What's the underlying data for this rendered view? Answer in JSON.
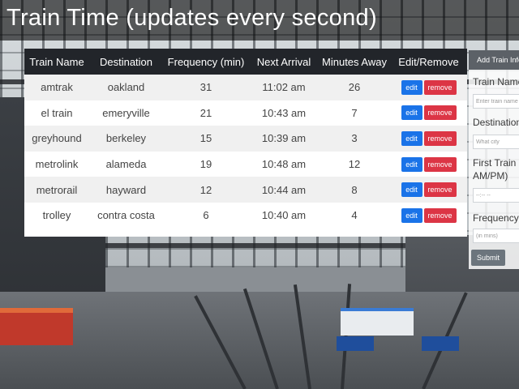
{
  "page": {
    "title": "Train Time (updates every second)"
  },
  "table": {
    "headers": [
      "Train Name",
      "Destination",
      "Frequency (min)",
      "Next Arrival",
      "Minutes Away",
      "Edit/Remove"
    ],
    "rows": [
      {
        "name": "amtrak",
        "destination": "oakland",
        "frequency": "31",
        "next_arrival": "11:02 am",
        "minutes_away": "26"
      },
      {
        "name": "el train",
        "destination": "emeryville",
        "frequency": "21",
        "next_arrival": "10:43 am",
        "minutes_away": "7"
      },
      {
        "name": "greyhound",
        "destination": "berkeley",
        "frequency": "15",
        "next_arrival": "10:39 am",
        "minutes_away": "3"
      },
      {
        "name": "metrolink",
        "destination": "alameda",
        "frequency": "19",
        "next_arrival": "10:48 am",
        "minutes_away": "12"
      },
      {
        "name": "metrorail",
        "destination": "hayward",
        "frequency": "12",
        "next_arrival": "10:44 am",
        "minutes_away": "8"
      },
      {
        "name": "trolley",
        "destination": "contra costa",
        "frequency": "6",
        "next_arrival": "10:40 am",
        "minutes_away": "4"
      }
    ],
    "edit_label": "edit",
    "remove_label": "remove"
  },
  "add_panel": {
    "header": "Add Train Info",
    "name_label": "Train Name",
    "name_placeholder": "Enter train name",
    "destination_label": "Destination",
    "destination_placeholder": "What city",
    "first_train_label_line1": "First Train",
    "first_train_label_line2": "AM/PM)",
    "first_train_placeholder": "--:-- --",
    "frequency_label": "Frequency",
    "frequency_placeholder": "(in mins)",
    "submit_label": "Submit"
  },
  "colors": {
    "edit": "#1a73e8",
    "remove": "#dc3545",
    "header": "#22252a",
    "submit": "#6c757d"
  }
}
